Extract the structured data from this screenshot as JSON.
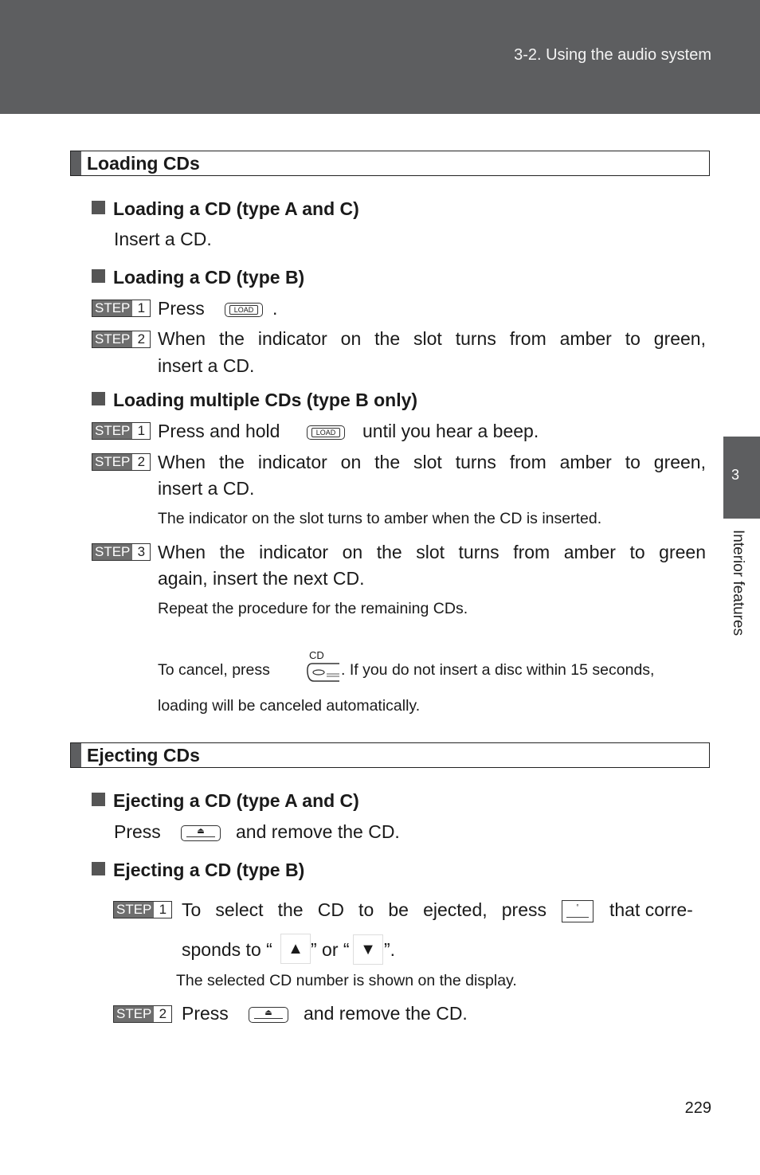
{
  "header": {
    "title": "3-2. Using the audio system"
  },
  "side_tab": {
    "chapter": "3",
    "label": "Interior features"
  },
  "page_number": "229",
  "loading": {
    "title": "Loading CDs",
    "a_c": {
      "heading": "Loading a CD (type A and C)",
      "text": "Insert a CD."
    },
    "b": {
      "heading": "Loading a CD (type B)",
      "step1": {
        "label": "STEP",
        "num": "1",
        "before": "Press",
        "after": "."
      },
      "step2": {
        "label": "STEP",
        "num": "2",
        "line1": "When the indicator on the slot turns from amber to green,",
        "line2": "insert a CD."
      }
    },
    "multi": {
      "heading": "Loading multiple CDs (type B only)",
      "step1": {
        "label": "STEP",
        "num": "1",
        "before": "Press and hold",
        "after": "until you hear a beep."
      },
      "step2": {
        "label": "STEP",
        "num": "2",
        "line1": "When the indicator on the slot turns from amber to green,",
        "line2": "insert a CD.",
        "note": "The indicator on the slot turns to amber when the CD is inserted."
      },
      "step3": {
        "label": "STEP",
        "num": "3",
        "line1": "When the indicator on the slot turns from amber to green",
        "line2": "again, insert the next CD.",
        "note": "Repeat the procedure for the remaining CDs."
      },
      "cancel_before": "To cancel, press",
      "cancel_after": ". If you do not insert a disc within 15 seconds,",
      "cancel_line2": "loading will be canceled automatically."
    }
  },
  "ejecting": {
    "title": "Ejecting CDs",
    "a_c": {
      "heading": "Ejecting a CD (type A and C)",
      "before": "Press",
      "after": "and remove the CD."
    },
    "b": {
      "heading": "Ejecting a CD (type B)",
      "step1": {
        "label": "STEP",
        "num": "1",
        "line1": "To select the CD to be ejected, press",
        "line1_after": "that corre-",
        "line2_a": "sponds to “",
        "line2_b": "” or “",
        "line2_c": "”.",
        "note": "The selected CD number is shown on the display."
      },
      "step2": {
        "label": "STEP",
        "num": "2",
        "before": "Press",
        "after": "and remove the CD."
      }
    }
  },
  "buttons": {
    "load": "LOAD",
    "cd": "CD",
    "eject": "⏏",
    "seek": "°",
    "up": "▲",
    "down": "▼"
  }
}
